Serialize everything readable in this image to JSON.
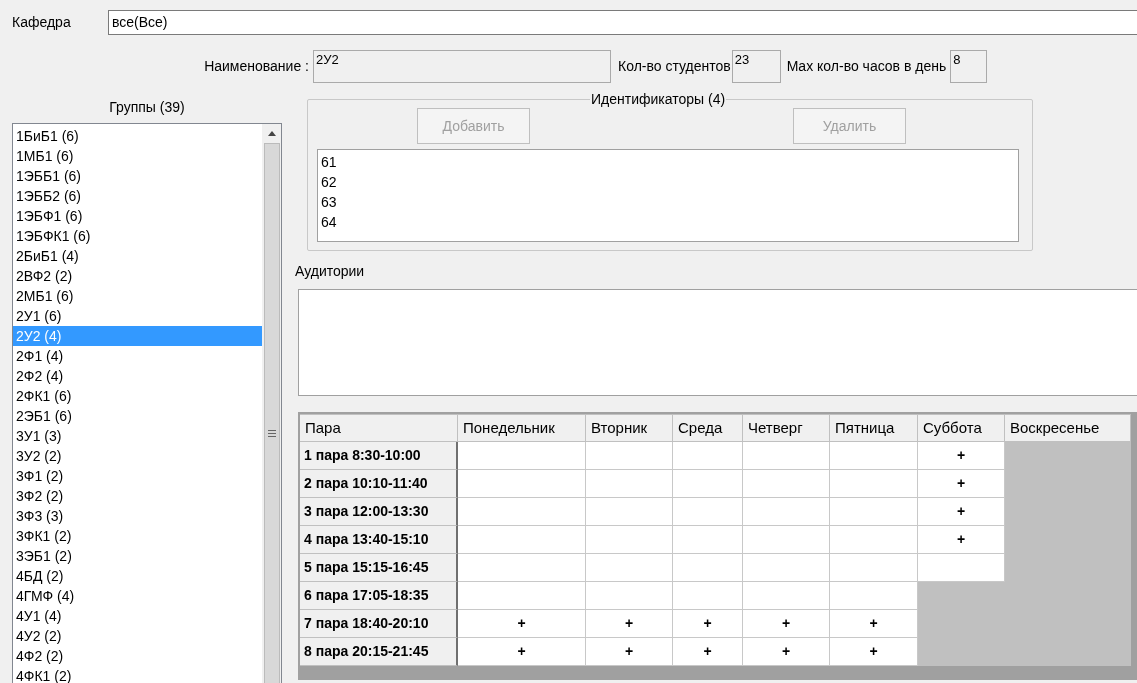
{
  "department": {
    "label": "Кафедра",
    "value": "все(Все)"
  },
  "info": {
    "name_label": "Наименование :",
    "name_value": "2У2",
    "students_label": "Кол-во студентов",
    "students_value": "23",
    "hours_label": "Max кол-во часов в день",
    "hours_value": "8"
  },
  "groups": {
    "title": "Группы (39)",
    "items": [
      {
        "label": "1БиБ1 (6)",
        "selected": false
      },
      {
        "label": "1МБ1 (6)",
        "selected": false
      },
      {
        "label": "1ЭББ1 (6)",
        "selected": false
      },
      {
        "label": "1ЭББ2 (6)",
        "selected": false
      },
      {
        "label": "1ЭБФ1 (6)",
        "selected": false
      },
      {
        "label": "1ЭБФК1 (6)",
        "selected": false
      },
      {
        "label": "2БиБ1 (4)",
        "selected": false
      },
      {
        "label": "2ВФ2 (2)",
        "selected": false
      },
      {
        "label": "2МБ1 (6)",
        "selected": false
      },
      {
        "label": "2У1 (6)",
        "selected": false
      },
      {
        "label": "2У2 (4)",
        "selected": true
      },
      {
        "label": "2Ф1 (4)",
        "selected": false
      },
      {
        "label": "2Ф2 (4)",
        "selected": false
      },
      {
        "label": "2ФК1 (6)",
        "selected": false
      },
      {
        "label": "2ЭБ1 (6)",
        "selected": false
      },
      {
        "label": "3У1 (3)",
        "selected": false
      },
      {
        "label": "3У2 (2)",
        "selected": false
      },
      {
        "label": "3Ф1 (2)",
        "selected": false
      },
      {
        "label": "3Ф2 (2)",
        "selected": false
      },
      {
        "label": "3Ф3 (3)",
        "selected": false
      },
      {
        "label": "3ФК1 (2)",
        "selected": false
      },
      {
        "label": "3ЭБ1 (2)",
        "selected": false
      },
      {
        "label": "4БД (2)",
        "selected": false
      },
      {
        "label": "4ГМФ (4)",
        "selected": false
      },
      {
        "label": "4У1 (4)",
        "selected": false
      },
      {
        "label": "4У2 (2)",
        "selected": false
      },
      {
        "label": "4Ф2 (2)",
        "selected": false
      },
      {
        "label": "4ФК1 (2)",
        "selected": false
      }
    ]
  },
  "identifiers": {
    "title": "Идентификаторы (4)",
    "buttons": [
      {
        "label": "Добавить",
        "disabled": true
      },
      {
        "label": "Удалить",
        "disabled": true
      }
    ],
    "items": [
      "61",
      "62",
      "63",
      "64"
    ]
  },
  "rooms": {
    "label": "Аудитории"
  },
  "schedule": {
    "columns": [
      "Пара",
      "Понедельник",
      "Вторник",
      "Среда",
      "Четверг",
      "Пятница",
      "Суббота",
      "Воскресенье"
    ],
    "rows": [
      [
        {
          "kind": "label",
          "text": "1 пара 8:30-10:00"
        },
        {
          "kind": "empty"
        },
        {
          "kind": "empty"
        },
        {
          "kind": "empty"
        },
        {
          "kind": "empty"
        },
        {
          "kind": "empty"
        },
        {
          "kind": "mark",
          "text": "+"
        },
        {
          "kind": "none"
        }
      ],
      [
        {
          "kind": "label",
          "text": "2 пара 10:10-11:40"
        },
        {
          "kind": "empty"
        },
        {
          "kind": "empty"
        },
        {
          "kind": "empty"
        },
        {
          "kind": "empty"
        },
        {
          "kind": "empty"
        },
        {
          "kind": "mark",
          "text": "+"
        },
        {
          "kind": "none"
        }
      ],
      [
        {
          "kind": "label",
          "text": "3 пара 12:00-13:30"
        },
        {
          "kind": "empty"
        },
        {
          "kind": "empty"
        },
        {
          "kind": "empty"
        },
        {
          "kind": "empty"
        },
        {
          "kind": "empty"
        },
        {
          "kind": "mark",
          "text": "+"
        },
        {
          "kind": "none"
        }
      ],
      [
        {
          "kind": "label",
          "text": "4 пара 13:40-15:10"
        },
        {
          "kind": "empty"
        },
        {
          "kind": "empty"
        },
        {
          "kind": "empty"
        },
        {
          "kind": "empty"
        },
        {
          "kind": "empty"
        },
        {
          "kind": "mark",
          "text": "+"
        },
        {
          "kind": "none"
        }
      ],
      [
        {
          "kind": "label",
          "text": "5 пара 15:15-16:45"
        },
        {
          "kind": "empty"
        },
        {
          "kind": "empty"
        },
        {
          "kind": "empty"
        },
        {
          "kind": "empty"
        },
        {
          "kind": "empty"
        },
        {
          "kind": "empty"
        },
        {
          "kind": "none"
        }
      ],
      [
        {
          "kind": "label",
          "text": "6 пара 17:05-18:35"
        },
        {
          "kind": "empty"
        },
        {
          "kind": "empty"
        },
        {
          "kind": "empty"
        },
        {
          "kind": "empty"
        },
        {
          "kind": "empty"
        },
        {
          "kind": "none"
        },
        {
          "kind": "none"
        }
      ],
      [
        {
          "kind": "label",
          "text": "7 пара 18:40-20:10"
        },
        {
          "kind": "mark",
          "text": "+"
        },
        {
          "kind": "mark",
          "text": "+"
        },
        {
          "kind": "mark",
          "text": "+"
        },
        {
          "kind": "mark",
          "text": "+"
        },
        {
          "kind": "mark",
          "text": "+"
        },
        {
          "kind": "none"
        },
        {
          "kind": "none"
        }
      ],
      [
        {
          "kind": "label",
          "text": "8 пара 20:15-21:45"
        },
        {
          "kind": "mark",
          "text": "+"
        },
        {
          "kind": "mark",
          "text": "+"
        },
        {
          "kind": "mark",
          "text": "+"
        },
        {
          "kind": "mark",
          "text": "+"
        },
        {
          "kind": "mark",
          "text": "+"
        },
        {
          "kind": "none"
        },
        {
          "kind": "none"
        }
      ]
    ]
  }
}
